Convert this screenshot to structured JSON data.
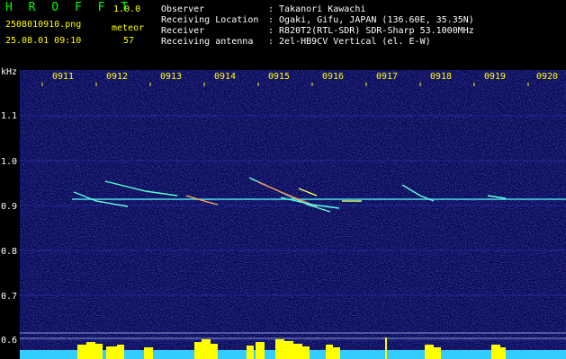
{
  "app": {
    "name": "H R O F F T",
    "version": "1.0.0"
  },
  "file": {
    "filename": "2508010910.png",
    "datetime": "25.08.01 09:10"
  },
  "meteor": {
    "label": "meteor",
    "count": "57"
  },
  "info": [
    {
      "key": "Observer",
      "value": ": Takanori Kawachi"
    },
    {
      "key": "Receiving Location",
      "value": ": Ogaki, Gifu, JAPAN (136.60E, 35.35N)"
    },
    {
      "key": "Receiver",
      "value": ": R820T2(RTL-SDR) SDR-Sharp 53.1000MHz"
    },
    {
      "key": "Receiving antenna",
      "value": ": 2el-HB9CV Vertical (el. E-W)"
    }
  ],
  "axes": {
    "y_unit": "kHz",
    "y_ticks": [
      "1.1",
      "1.0",
      "0.9",
      "0.8",
      "0.7",
      "0.6"
    ],
    "x_ticks": [
      "0911",
      "0912",
      "0913",
      "0914",
      "0915",
      "0916",
      "0917",
      "0918",
      "0919",
      "0920"
    ]
  },
  "colors": {
    "background": "#000000",
    "spectrogram": "#0a0a5a",
    "label_yellow": "#ffff00",
    "label_green": "#00ff00",
    "signal_cyan": "#55ffff"
  }
}
